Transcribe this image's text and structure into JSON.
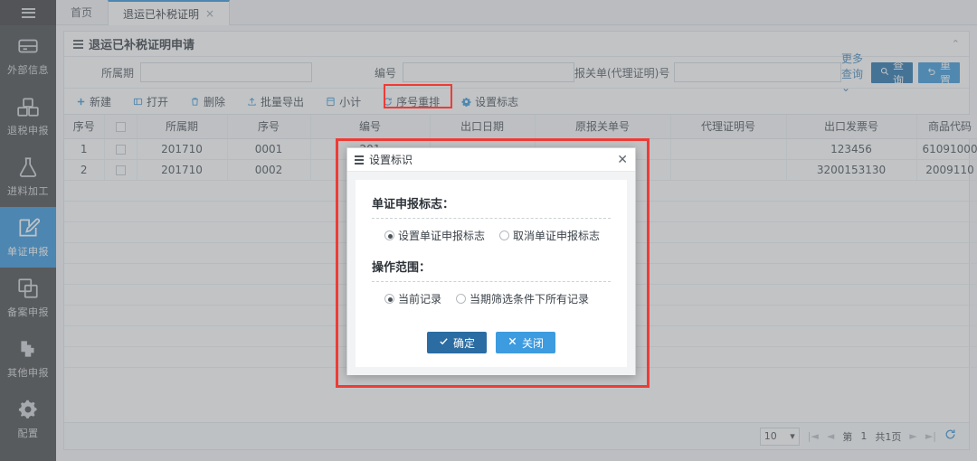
{
  "sidebar": {
    "menu_icon": "hamburger-icon",
    "items": [
      {
        "label": "外部信息",
        "icon": "database-icon",
        "active": false
      },
      {
        "label": "退税申报",
        "icon": "boxes-icon",
        "active": false
      },
      {
        "label": "进料加工",
        "icon": "flask-icon",
        "active": false
      },
      {
        "label": "单证申报",
        "icon": "edit-document-icon",
        "active": true
      },
      {
        "label": "备案申报",
        "icon": "copy-icon",
        "active": false
      },
      {
        "label": "其他申报",
        "icon": "plugin-icon",
        "active": false
      },
      {
        "label": "配置",
        "icon": "gears-icon",
        "active": false
      }
    ]
  },
  "tabs": [
    {
      "label": "首页",
      "active": false,
      "closable": false
    },
    {
      "label": "退运已补税证明",
      "active": true,
      "closable": true,
      "close_glyph": "×"
    }
  ],
  "panel": {
    "title": "退运已补税证明申请",
    "collapse_glyph": "⌃"
  },
  "search": {
    "fields": [
      {
        "label": "所属期",
        "value": "",
        "placeholder": ""
      },
      {
        "label": "编号",
        "value": "",
        "placeholder": ""
      },
      {
        "label": "报关单(代理证明)号",
        "value": "",
        "placeholder": ""
      }
    ],
    "more_query": "更多查询",
    "more_query_caret": "⌄",
    "query_button": "查询",
    "query_icon": "search-icon",
    "reset_button": "重置",
    "reset_icon": "undo-icon"
  },
  "toolbar": {
    "items": [
      {
        "label": "新建",
        "icon": "plus-icon"
      },
      {
        "label": "打开",
        "icon": "open-folder-icon"
      },
      {
        "label": "删除",
        "icon": "trash-icon"
      },
      {
        "label": "批量导出",
        "icon": "upload-export-icon"
      },
      {
        "label": "小计",
        "icon": "calculator-icon"
      },
      {
        "label": "序号重排",
        "icon": "refresh-icon"
      },
      {
        "label": "设置标志",
        "icon": "gear-icon",
        "highlighted": true
      }
    ]
  },
  "table": {
    "columns": [
      "序号",
      "",
      "所属期",
      "序号",
      "编号",
      "出口日期",
      "原报关单号",
      "代理证明号",
      "出口发票号",
      "商品代码"
    ],
    "rows": [
      {
        "seq": "1",
        "check": "",
        "period": "201710",
        "index": "0001",
        "number": "201",
        "export_date": "",
        "original_decl": "",
        "agent_cert": "",
        "export_invoice": "123456",
        "goods_code": "61091000"
      },
      {
        "seq": "2",
        "check": "",
        "period": "201710",
        "index": "0002",
        "number": "201",
        "export_date": "",
        "original_decl": "",
        "agent_cert": "",
        "export_invoice": "3200153130",
        "goods_code": "2009110"
      }
    ],
    "empty_row_count": 9
  },
  "pagination": {
    "page_size": "10",
    "page_size_caret": "▾",
    "first_glyph": "|◄",
    "prev_glyph": "◄",
    "page_label": "第",
    "page_number": "1",
    "total_label": "共1页",
    "next_glyph": "►",
    "last_glyph": "►|",
    "refresh_icon": "refresh-icon"
  },
  "modal": {
    "title": "设置标识",
    "menu_icon": "hamburger-icon",
    "close_glyph": "✕",
    "section1_title": "单证申报标志：",
    "section1_options": [
      {
        "label": "设置单证申报标志",
        "selected": true
      },
      {
        "label": "取消单证申报标志",
        "selected": false
      }
    ],
    "section2_title": "操作范围：",
    "section2_options": [
      {
        "label": "当前记录",
        "selected": true
      },
      {
        "label": "当期筛选条件下所有记录",
        "selected": false
      }
    ],
    "ok_button": "确定",
    "ok_icon": "check-icon",
    "close_button": "关闭",
    "close_icon": "x-icon"
  },
  "annotations": {
    "highlight_color": "#ef3b36",
    "boxes": [
      "设置标志 toolbar button",
      "设置标识 modal dialog"
    ]
  },
  "colors": {
    "accent": "#2a8fd8",
    "sidebar_bg": "#3e3f41",
    "button_primary": "#1b6ba8",
    "button_secondary": "#2f93d8",
    "highlight": "#ef3b36"
  }
}
